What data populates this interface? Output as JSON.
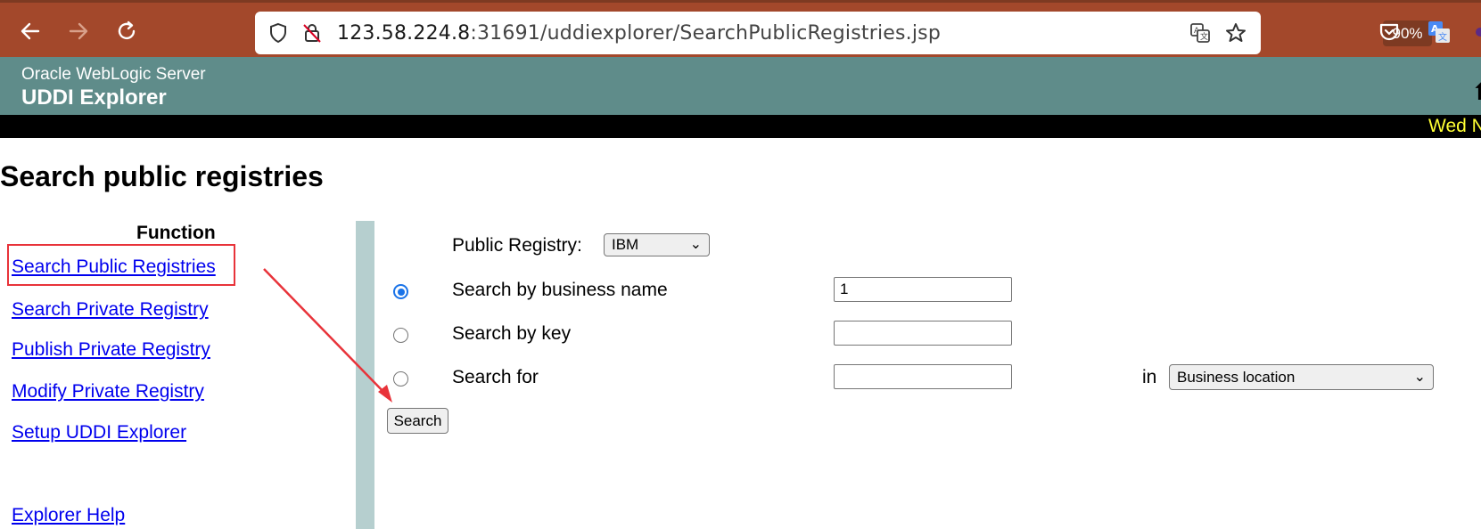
{
  "browser": {
    "url_host": "123.58.224.8",
    "url_rest": ":31691/uddiexplorer/SearchPublicRegistries.jsp",
    "zoom": "90%"
  },
  "header": {
    "subtitle": "Oracle WebLogic Server",
    "title": "UDDI Explorer",
    "date": "Wed N"
  },
  "page": {
    "title": "Search public registries"
  },
  "sidebar": {
    "heading": "Function",
    "links": [
      "Search Public Registries",
      "Search Private Registry",
      "Publish Private Registry",
      "Modify Private Registry",
      "Setup UDDI Explorer",
      "Explorer Help"
    ]
  },
  "form": {
    "registry_label": "Public Registry:",
    "registry_value": "IBM",
    "option_business_name": "Search by business name",
    "business_name_value": "1",
    "option_key": "Search by key",
    "key_value": "",
    "option_search_for": "Search for",
    "search_for_value": "",
    "in_label": "in",
    "in_value": "Business location",
    "search_button": "Search"
  },
  "colors": {
    "browser_bar": "#a3482b",
    "header": "#5f8c8a",
    "date_bar": "#000000",
    "date_text": "#ffff33",
    "link": "#0000ee",
    "highlight": "#e8333a",
    "divider": "#b6cfcf"
  }
}
